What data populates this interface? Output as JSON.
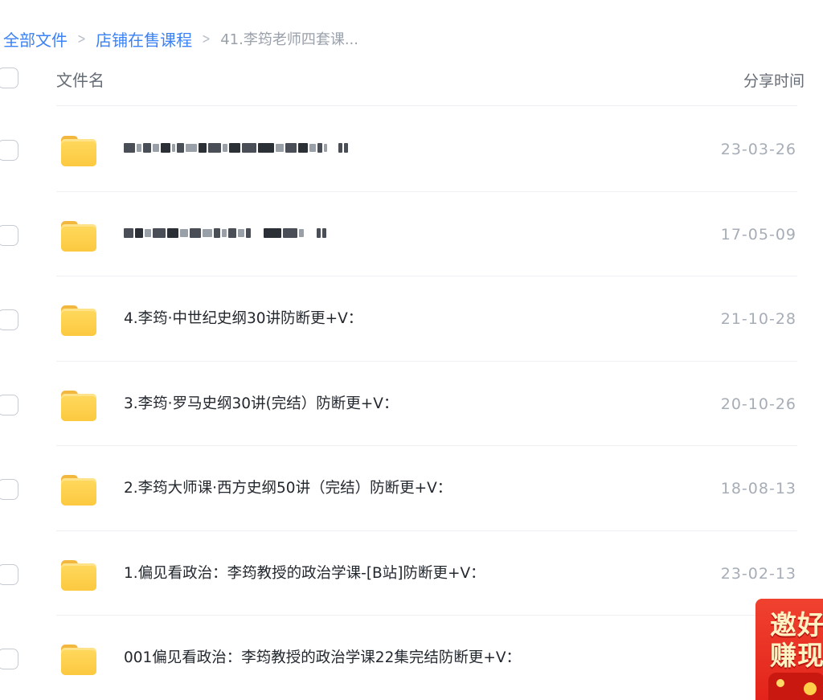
{
  "breadcrumb": {
    "items": [
      "全部文件",
      "店铺在售课程"
    ],
    "current": "41.李筠老师四套课...",
    "separator": ">"
  },
  "header": {
    "name_label": "文件名",
    "time_label": "分享时间"
  },
  "files": [
    {
      "name": "",
      "date": "23-03-26",
      "blurred": true
    },
    {
      "name": "",
      "date": "17-05-09",
      "blurred": true
    },
    {
      "name": "4.李筠·中世纪史纲30讲防断更+V：",
      "date": "21-10-28"
    },
    {
      "name": "3.李筠·罗马史纲30讲(完结）防断更+V：",
      "date": "20-10-26"
    },
    {
      "name": "2.李筠大师课·西方史纲50讲（完结）防断更+V：",
      "date": "18-08-13"
    },
    {
      "name": "1.偏见看政治：李筠教授的政治学课-[B站]防断更+V：",
      "date": "23-02-13"
    },
    {
      "name": "001偏见看政治：李筠教授的政治学课22集完结防断更+V：",
      "date": "23-0"
    }
  ],
  "promo": {
    "line1": "邀好",
    "line2": "赚现"
  },
  "colors": {
    "link": "#3b82f6",
    "folder": "#fcc940",
    "promo_bg": "#e3231b"
  },
  "icons": {
    "folder": "folder-icon",
    "checkbox": "checkbox-icon",
    "chevron": "chevron-right-icon"
  }
}
